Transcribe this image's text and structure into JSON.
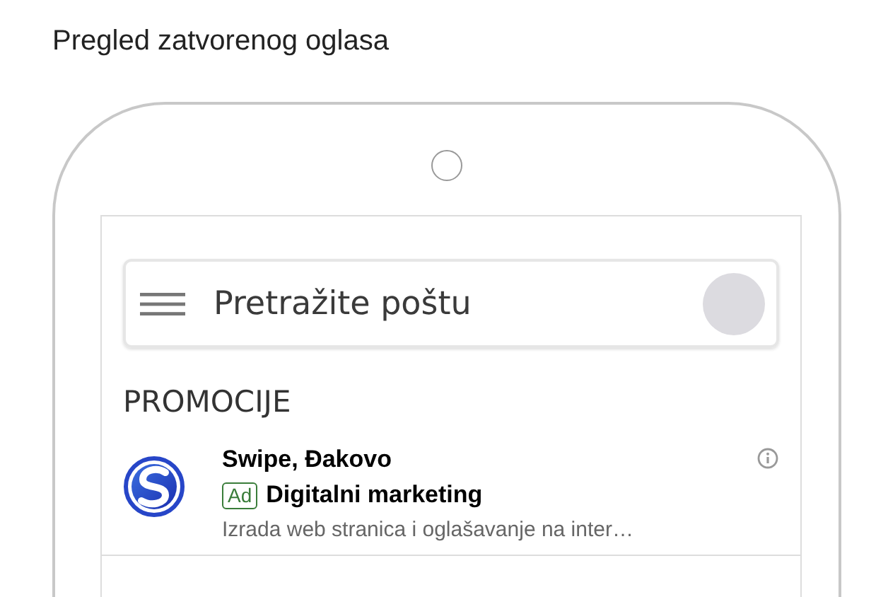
{
  "title": "Pregled zatvorenog oglasa",
  "search": {
    "placeholder": "Pretražite poštu"
  },
  "section": "PROMOCIJE",
  "ad": {
    "advertiser": "Swipe, Đakovo",
    "badge": "Ad",
    "headline": "Digitalni marketing",
    "description": "Izrada web stranica i oglašavanje na inter…"
  }
}
